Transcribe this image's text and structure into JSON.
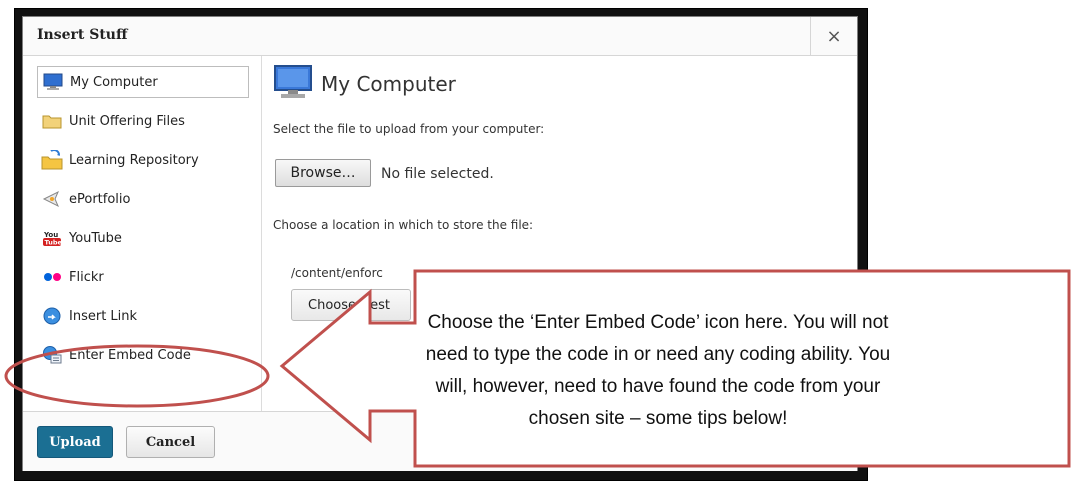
{
  "dialog": {
    "title": "Insert Stuff",
    "close_label": "×"
  },
  "sidebar": {
    "items": [
      {
        "label": "My Computer",
        "icon": "monitor-icon",
        "selected": true
      },
      {
        "label": "Unit Offering Files",
        "icon": "folder-icon"
      },
      {
        "label": "Learning Repository",
        "icon": "repository-folder-icon"
      },
      {
        "label": "ePortfolio",
        "icon": "eportfolio-icon"
      },
      {
        "label": "YouTube",
        "icon": "youtube-icon"
      },
      {
        "label": "Flickr",
        "icon": "flickr-icon"
      },
      {
        "label": "Insert Link",
        "icon": "link-globe-icon"
      },
      {
        "label": "Enter Embed Code",
        "icon": "embed-code-icon"
      }
    ]
  },
  "main": {
    "heading": "My Computer",
    "select_file_text": "Select the file to upload from your computer:",
    "browse_label": "Browse…",
    "no_file_text": "No file selected.",
    "location_text": "Choose a location in which to store the file:",
    "path_text": "/content/enforc",
    "choose_destination_label": "Choose Dest"
  },
  "footer": {
    "upload_label": "Upload",
    "cancel_label": "Cancel",
    "resize_glyph": "//"
  },
  "callout": {
    "text": "Choose the ‘Enter Embed Code’ icon here. You will not need to type the code in or need any coding ability. You will, however, need to have found the code from your chosen site – some tips below!",
    "accent": "#c0504d"
  }
}
